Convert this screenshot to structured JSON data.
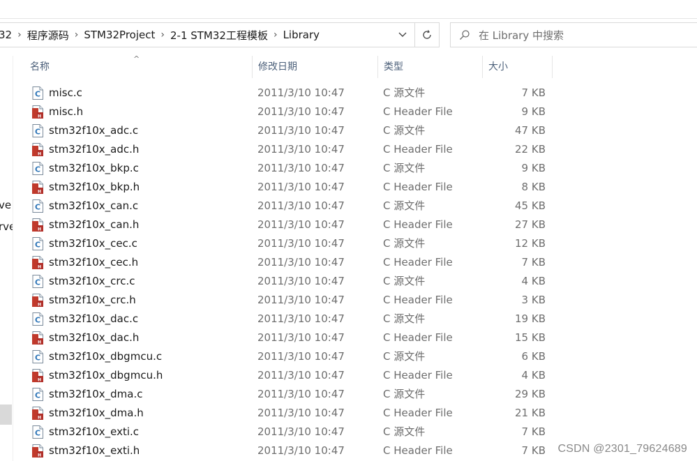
{
  "breadcrumb": {
    "items": [
      "32",
      "程序源码",
      "STM32Project",
      "2-1 STM32工程模板",
      "Library"
    ],
    "separator": "›"
  },
  "search": {
    "placeholder": "在 Library 中搜索"
  },
  "left_pane": {
    "items": [
      "ve",
      "rve"
    ]
  },
  "columns": {
    "name": "名称",
    "date": "修改日期",
    "type": "类型",
    "size": "大小"
  },
  "files": [
    {
      "name": "misc.c",
      "date": "2011/3/10 10:47",
      "type": "C 源文件",
      "size": "7 KB",
      "icon": "c-source-icon"
    },
    {
      "name": "misc.h",
      "date": "2011/3/10 10:47",
      "type": "C Header File",
      "size": "9 KB",
      "icon": "c-header-icon"
    },
    {
      "name": "stm32f10x_adc.c",
      "date": "2011/3/10 10:47",
      "type": "C 源文件",
      "size": "47 KB",
      "icon": "c-source-icon"
    },
    {
      "name": "stm32f10x_adc.h",
      "date": "2011/3/10 10:47",
      "type": "C Header File",
      "size": "22 KB",
      "icon": "c-header-icon"
    },
    {
      "name": "stm32f10x_bkp.c",
      "date": "2011/3/10 10:47",
      "type": "C 源文件",
      "size": "9 KB",
      "icon": "c-source-icon"
    },
    {
      "name": "stm32f10x_bkp.h",
      "date": "2011/3/10 10:47",
      "type": "C Header File",
      "size": "8 KB",
      "icon": "c-header-icon"
    },
    {
      "name": "stm32f10x_can.c",
      "date": "2011/3/10 10:47",
      "type": "C 源文件",
      "size": "45 KB",
      "icon": "c-source-icon"
    },
    {
      "name": "stm32f10x_can.h",
      "date": "2011/3/10 10:47",
      "type": "C Header File",
      "size": "27 KB",
      "icon": "c-header-icon"
    },
    {
      "name": "stm32f10x_cec.c",
      "date": "2011/3/10 10:47",
      "type": "C 源文件",
      "size": "12 KB",
      "icon": "c-source-icon"
    },
    {
      "name": "stm32f10x_cec.h",
      "date": "2011/3/10 10:47",
      "type": "C Header File",
      "size": "7 KB",
      "icon": "c-header-icon"
    },
    {
      "name": "stm32f10x_crc.c",
      "date": "2011/3/10 10:47",
      "type": "C 源文件",
      "size": "4 KB",
      "icon": "c-source-icon"
    },
    {
      "name": "stm32f10x_crc.h",
      "date": "2011/3/10 10:47",
      "type": "C Header File",
      "size": "3 KB",
      "icon": "c-header-icon"
    },
    {
      "name": "stm32f10x_dac.c",
      "date": "2011/3/10 10:47",
      "type": "C 源文件",
      "size": "19 KB",
      "icon": "c-source-icon"
    },
    {
      "name": "stm32f10x_dac.h",
      "date": "2011/3/10 10:47",
      "type": "C Header File",
      "size": "15 KB",
      "icon": "c-header-icon"
    },
    {
      "name": "stm32f10x_dbgmcu.c",
      "date": "2011/3/10 10:47",
      "type": "C 源文件",
      "size": "6 KB",
      "icon": "c-source-icon"
    },
    {
      "name": "stm32f10x_dbgmcu.h",
      "date": "2011/3/10 10:47",
      "type": "C Header File",
      "size": "4 KB",
      "icon": "c-header-icon"
    },
    {
      "name": "stm32f10x_dma.c",
      "date": "2011/3/10 10:47",
      "type": "C 源文件",
      "size": "29 KB",
      "icon": "c-source-icon"
    },
    {
      "name": "stm32f10x_dma.h",
      "date": "2011/3/10 10:47",
      "type": "C Header File",
      "size": "21 KB",
      "icon": "c-header-icon"
    },
    {
      "name": "stm32f10x_exti.c",
      "date": "2011/3/10 10:47",
      "type": "C 源文件",
      "size": "7 KB",
      "icon": "c-source-icon"
    },
    {
      "name": "stm32f10x_exti.h",
      "date": "2011/3/10 10:47",
      "type": "C Header File",
      "size": "7 KB",
      "icon": "c-header-icon"
    }
  ],
  "watermark": "CSDN @2301_79624689"
}
